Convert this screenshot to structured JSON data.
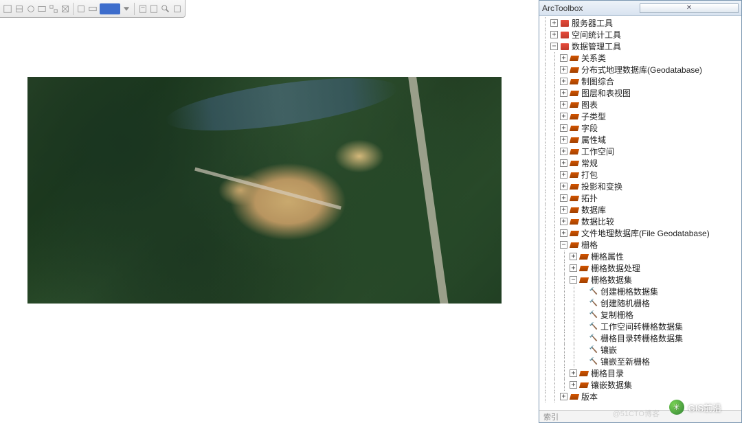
{
  "panel": {
    "title": "ArcToolbox"
  },
  "footer": {
    "text": "索引"
  },
  "watermark": {
    "label": "GIS前沿",
    "url": "@51CTO博客"
  },
  "tree": [
    {
      "d": 0,
      "t": "toolbox",
      "e": "+",
      "label": "服务器工具"
    },
    {
      "d": 0,
      "t": "toolbox",
      "e": "+",
      "label": "空间统计工具"
    },
    {
      "d": 0,
      "t": "toolbox",
      "e": "-",
      "label": "数据管理工具"
    },
    {
      "d": 1,
      "t": "toolset",
      "e": "+",
      "label": "关系类"
    },
    {
      "d": 1,
      "t": "toolset",
      "e": "+",
      "label": "分布式地理数据库(Geodatabase)"
    },
    {
      "d": 1,
      "t": "toolset",
      "e": "+",
      "label": "制图综合"
    },
    {
      "d": 1,
      "t": "toolset",
      "e": "+",
      "label": "图层和表视图"
    },
    {
      "d": 1,
      "t": "toolset",
      "e": "+",
      "label": "图表"
    },
    {
      "d": 1,
      "t": "toolset",
      "e": "+",
      "label": "子类型"
    },
    {
      "d": 1,
      "t": "toolset",
      "e": "+",
      "label": "字段"
    },
    {
      "d": 1,
      "t": "toolset",
      "e": "+",
      "label": "属性域"
    },
    {
      "d": 1,
      "t": "toolset",
      "e": "+",
      "label": "工作空间"
    },
    {
      "d": 1,
      "t": "toolset",
      "e": "+",
      "label": "常规"
    },
    {
      "d": 1,
      "t": "toolset",
      "e": "+",
      "label": "打包"
    },
    {
      "d": 1,
      "t": "toolset",
      "e": "+",
      "label": "投影和变换"
    },
    {
      "d": 1,
      "t": "toolset",
      "e": "+",
      "label": "拓扑"
    },
    {
      "d": 1,
      "t": "toolset",
      "e": "+",
      "label": "数据库"
    },
    {
      "d": 1,
      "t": "toolset",
      "e": "+",
      "label": "数据比较"
    },
    {
      "d": 1,
      "t": "toolset",
      "e": "+",
      "label": "文件地理数据库(File Geodatabase)"
    },
    {
      "d": 1,
      "t": "toolset",
      "e": "-",
      "label": "栅格"
    },
    {
      "d": 2,
      "t": "toolset",
      "e": "+",
      "label": "栅格属性"
    },
    {
      "d": 2,
      "t": "toolset",
      "e": "+",
      "label": "栅格数据处理"
    },
    {
      "d": 2,
      "t": "toolset",
      "e": "-",
      "label": "栅格数据集"
    },
    {
      "d": 3,
      "t": "tool",
      "e": "",
      "label": "创建栅格数据集"
    },
    {
      "d": 3,
      "t": "tool",
      "e": "",
      "label": "创建随机栅格"
    },
    {
      "d": 3,
      "t": "tool",
      "e": "",
      "label": "复制栅格"
    },
    {
      "d": 3,
      "t": "tool",
      "e": "",
      "label": "工作空间转栅格数据集"
    },
    {
      "d": 3,
      "t": "tool",
      "e": "",
      "label": "栅格目录转栅格数据集"
    },
    {
      "d": 3,
      "t": "tool",
      "e": "",
      "label": "镶嵌"
    },
    {
      "d": 3,
      "t": "tool",
      "e": "",
      "label": "镶嵌至新栅格"
    },
    {
      "d": 2,
      "t": "toolset",
      "e": "+",
      "label": "栅格目录"
    },
    {
      "d": 2,
      "t": "toolset",
      "e": "+",
      "label": "镶嵌数据集"
    },
    {
      "d": 1,
      "t": "toolset",
      "e": "+",
      "label": "版本"
    }
  ]
}
